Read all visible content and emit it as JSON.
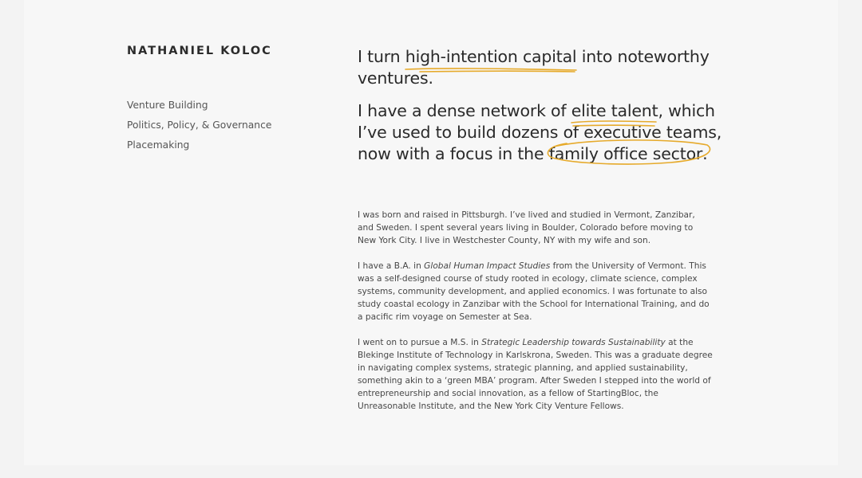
{
  "site": {
    "name": "NATHANIEL KOLOC"
  },
  "nav": {
    "items": [
      {
        "label": "Venture Building"
      },
      {
        "label": "Politics, Policy, & Governance"
      },
      {
        "label": "Placemaking"
      }
    ]
  },
  "headline": {
    "p1_pre": "I turn ",
    "p1_hl": "high-intention capital",
    "p1_post": " into noteworthy ventures.",
    "p2_pre": "I have a dense network of ",
    "p2_hl1": "elite talent",
    "p2_mid": ", which I’ve used to build dozens of executive teams, now with a focus in the ",
    "p2_hl2": "family office sector",
    "p2_post": "."
  },
  "bio": {
    "p1": "I was born and raised in Pittsburgh. I’ve lived and studied in Vermont, Zanzibar, and Sweden. I spent several years living in Boulder, Colorado before moving to New York City. I live in Westchester County, NY with my wife and son.",
    "p2_pre": "I have a B.A. in ",
    "p2_em": "Global Human Impact Studies",
    "p2_post": " from the University of Vermont. This was a self-designed course of study rooted in ecology, climate science, complex systems, community development, and applied economics. I was fortunate to also study coastal ecology in Zanzibar with the School for International Training, and do a pacific rim voyage on Semester at Sea.",
    "p3_pre": "I went on to pursue a M.S. in ",
    "p3_em": "Strategic Leadership towards Sustainability",
    "p3_post": " at the Blekinge Institute of Technology in Karlskrona, Sweden. This was a graduate degree in navigating complex systems, strategic planning, and applied sustainability, something akin to a ‘green MBA’ program. After Sweden I stepped into the world of entrepreneurship and social innovation, as a fellow of StartingBloc, the Unreasonable Institute, and the New York City Venture Fellows."
  },
  "colors": {
    "accent": "#e6aa2b",
    "text": "#2a2a2a",
    "background": "#f7f7f7"
  }
}
